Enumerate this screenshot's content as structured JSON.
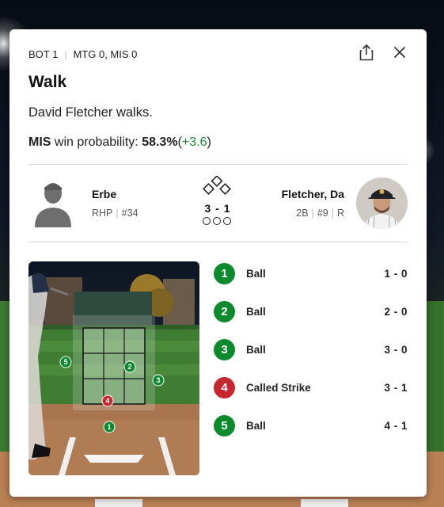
{
  "header": {
    "inning": "BOT 1",
    "score": "MTG 0, MIS 0",
    "share_icon": "share-icon",
    "close_icon": "close-icon"
  },
  "play": {
    "title": "Walk",
    "description": "David Fletcher walks.",
    "win_probability": {
      "team": "MIS",
      "label": "win probability:",
      "value": "58.3%",
      "open_paren": "(",
      "delta": "+3.6",
      "close_paren": ")"
    }
  },
  "matchup": {
    "pitcher": {
      "name": "Erbe",
      "hand": "RHP",
      "number": "#34"
    },
    "count": "3 - 1",
    "bases_occupied": [
      false,
      false,
      false
    ],
    "outs": 0,
    "batter": {
      "name": "Fletcher, Da",
      "position": "2B",
      "number": "#9",
      "bats": "R"
    }
  },
  "pitches": [
    {
      "num": "1",
      "result": "Ball",
      "count": "1 - 0",
      "type": "ball"
    },
    {
      "num": "2",
      "result": "Ball",
      "count": "2 - 0",
      "type": "ball"
    },
    {
      "num": "3",
      "result": "Ball",
      "count": "3 - 0",
      "type": "ball"
    },
    {
      "num": "4",
      "result": "Called Strike",
      "count": "3 - 1",
      "type": "strike"
    },
    {
      "num": "5",
      "result": "Ball",
      "count": "4 - 1",
      "type": "ball"
    }
  ],
  "colors": {
    "ball": "#0b8a2c",
    "strike": "#c8262f",
    "delta_positive": "#1a8a35"
  }
}
